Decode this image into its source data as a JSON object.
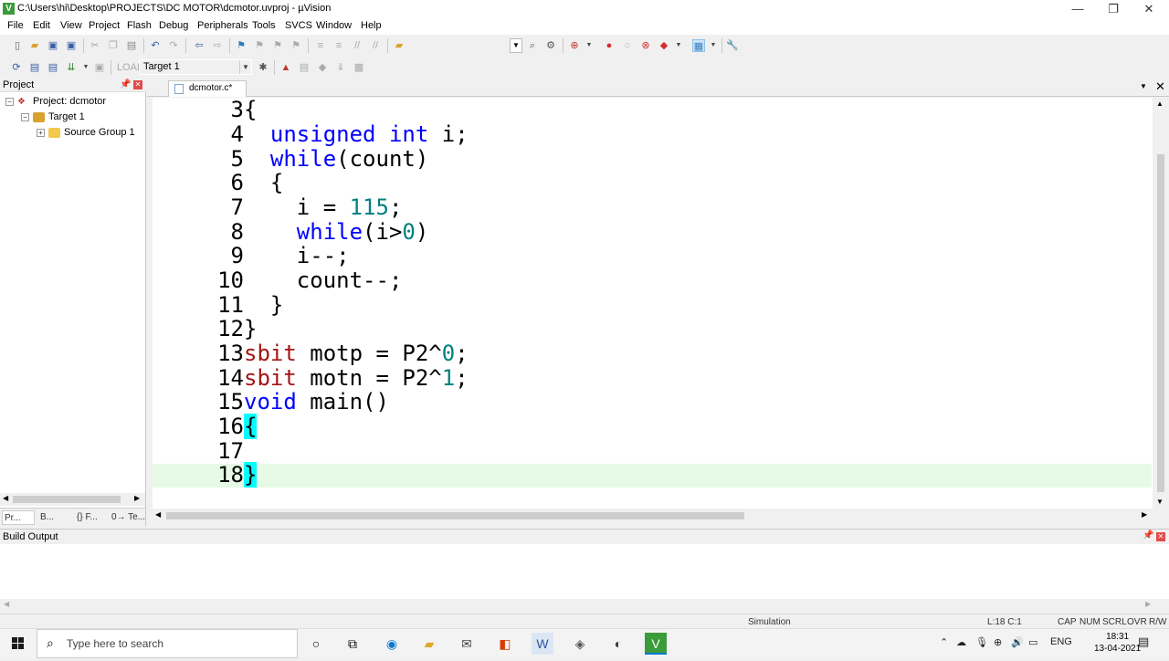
{
  "window": {
    "title": "C:\\Users\\hi\\Desktop\\PROJECTS\\DC MOTOR\\dcmotor.uvproj - µVision",
    "minimize": "—",
    "restore": "❐",
    "close": "✕"
  },
  "menu": [
    "File",
    "Edit",
    "View",
    "Project",
    "Flash",
    "Debug",
    "Peripherals",
    "Tools",
    "SVCS",
    "Window",
    "Help"
  ],
  "toolbar": {
    "target_value": "Target 1"
  },
  "project_panel": {
    "title": "Project",
    "pin": "⊓",
    "tree": {
      "project": "Project: dcmotor",
      "target": "Target 1",
      "group": "Source Group 1"
    },
    "tabs": [
      "Pr...",
      "B...",
      "{} F...",
      "0→ Te..."
    ]
  },
  "editor": {
    "tab_label": "dcmotor.c*",
    "lines": [
      {
        "n": "3"
      },
      {
        "n": "4"
      },
      {
        "n": "5"
      },
      {
        "n": "6"
      },
      {
        "n": "7"
      },
      {
        "n": "8"
      },
      {
        "n": "9"
      },
      {
        "n": "10"
      },
      {
        "n": "11"
      },
      {
        "n": "12"
      },
      {
        "n": "13"
      },
      {
        "n": "14"
      },
      {
        "n": "15"
      },
      {
        "n": "16"
      },
      {
        "n": "17"
      },
      {
        "n": "18"
      }
    ],
    "code": {
      "l3": "{",
      "l4_kw": "unsigned int",
      "l4_rest": " i;",
      "l5_kw": "while",
      "l5_rest": "(count)",
      "l6": "{",
      "l7_a": "i = ",
      "l7_num": "115",
      "l7_b": ";",
      "l8_kw": "while",
      "l8_a": "(i>",
      "l8_num": "0",
      "l8_b": ")",
      "l9": "i--;",
      "l10": "count--;",
      "l11": "}",
      "l12": "}",
      "l13_kw": "sbit",
      "l13_a": " motp = P2^",
      "l13_num": "0",
      "l13_b": ";",
      "l14_kw": "sbit",
      "l14_a": " motn = P2^",
      "l14_num": "1",
      "l14_b": ";",
      "l15_kw": "void",
      "l15_rest": " main()",
      "l16": "{",
      "l17": "",
      "l18": "}"
    }
  },
  "build_output": {
    "title": "Build Output"
  },
  "status_bar": {
    "mode": "Simulation",
    "position": "L:18 C:1",
    "caps": "CAP",
    "num": "NUM",
    "scrl": "SCRL",
    "ovr": "OVR",
    "rw": "R/W"
  },
  "taskbar": {
    "search_placeholder": "Type here to search",
    "language": "ENG",
    "time": "18:31",
    "date": "13-04-2021"
  },
  "colors": {
    "keyword": "#0000ff",
    "number": "#008080",
    "sbit": "#a31515",
    "brace_highlight": "#00ffff",
    "current_line": "#e6fae6"
  }
}
